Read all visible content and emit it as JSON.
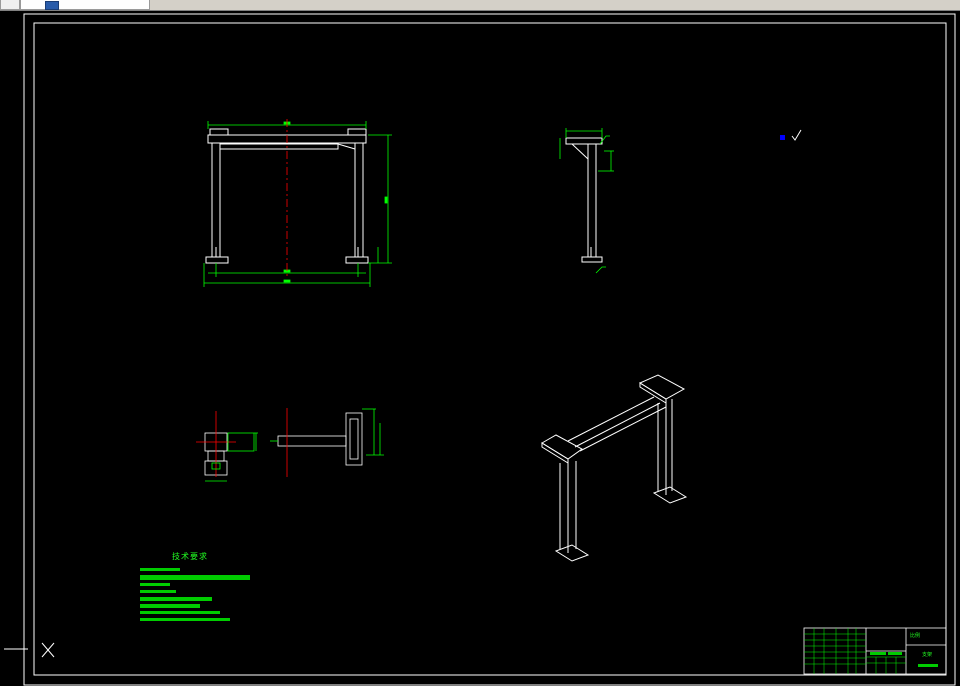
{
  "app": {
    "tabs": [
      {
        "label": ""
      },
      {
        "label": ""
      }
    ]
  },
  "drawing": {
    "technical_requirements_title": "技术要求",
    "title_block": {
      "scale_label": "比例",
      "drawing_name": "支架"
    }
  },
  "colors": {
    "background": "#000000",
    "frame": "#ffffff",
    "inner_frame": "#00ffff",
    "dimension": "#00ff00",
    "center_line": "#ff0000",
    "geometry": "#ffffff",
    "ucs_blue": "#0000ff"
  },
  "icons": {
    "ucs": "ucs-icon",
    "crosshair": "crosshair-cursor-icon",
    "layout": "layout-icon"
  }
}
